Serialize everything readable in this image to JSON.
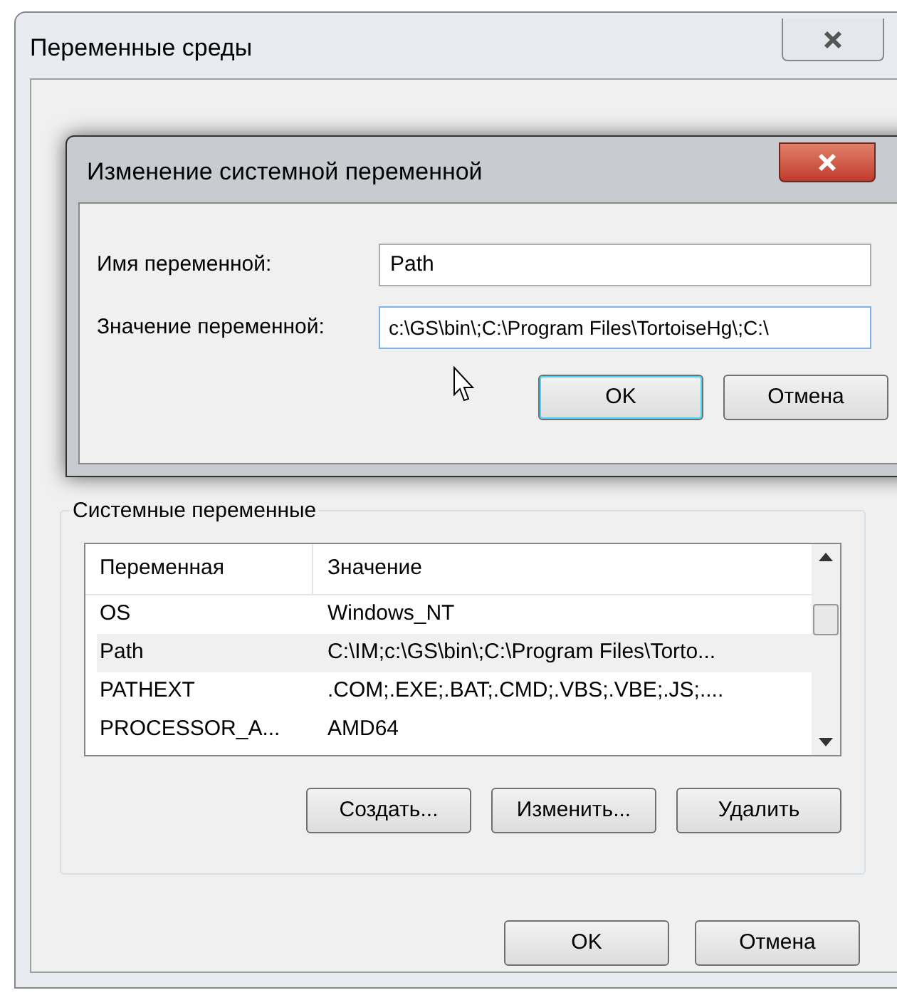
{
  "window": {
    "title": "Переменные среды"
  },
  "edit_dialog": {
    "title": "Изменение системной переменной",
    "name_label": "Имя переменной:",
    "name_value": "Path",
    "value_label": "Значение переменной:",
    "value_value": "c:\\GS\\bin\\;C:\\Program Files\\TortoiseHg\\;C:\\",
    "buttons": [
      {
        "label": "OK",
        "default": true
      },
      {
        "label": "Отмена",
        "default": false
      }
    ]
  },
  "system_variables": {
    "title": "Системные переменные",
    "columns": [
      "Переменная",
      "Значение"
    ],
    "rows": [
      {
        "name": "OS",
        "value": "Windows_NT",
        "selected": false
      },
      {
        "name": "Path",
        "value": "C:\\IM;c:\\GS\\bin\\;C:\\Program Files\\Torto...",
        "selected": true
      },
      {
        "name": "PATHEXT",
        "value": ".COM;.EXE;.BAT;.CMD;.VBS;.VBE;.JS;....",
        "selected": false
      },
      {
        "name": "PROCESSOR_A...",
        "value": "AMD64",
        "selected": false
      }
    ],
    "buttons": [
      "Создать...",
      "Изменить...",
      "Удалить"
    ]
  },
  "buttons": [
    "OK",
    "Отмена"
  ]
}
